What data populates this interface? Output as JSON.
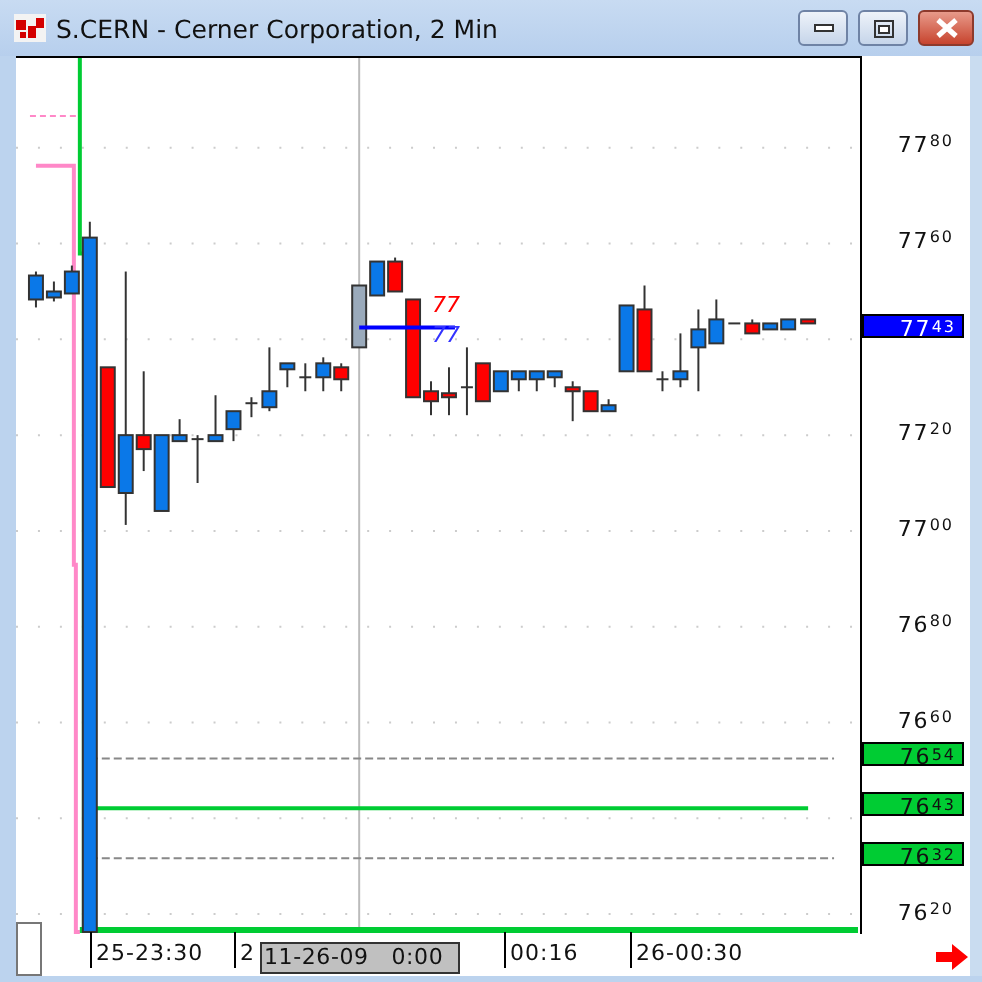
{
  "window": {
    "title": "S.CERN - Cerner Corporation, 2 Min"
  },
  "price_axis": {
    "labels": [
      "77$^{80}$",
      "77$^{60}$",
      "77$^{20}$",
      "77$^{00}$",
      "76$^{80}$",
      "76$^{60}$",
      "76$^{20}$"
    ]
  },
  "price_tags": [
    {
      "text": "77$^{43}$",
      "color": "#0000ff"
    },
    {
      "text": "76$^{54}$",
      "color": "#00cc33"
    },
    {
      "text": "76$^{43}$",
      "color": "#00cc33"
    },
    {
      "text": "76$^{32}$",
      "color": "#00cc33"
    }
  ],
  "markers": [
    {
      "text": "77",
      "color": "#ff0000"
    },
    {
      "text": "77",
      "color": "#3333ff"
    }
  ],
  "time_axis": {
    "labels": [
      "25-23:30",
      "2",
      "00:16",
      "26-00:30"
    ],
    "cursor_label": "11-26-09   0:00"
  }
}
